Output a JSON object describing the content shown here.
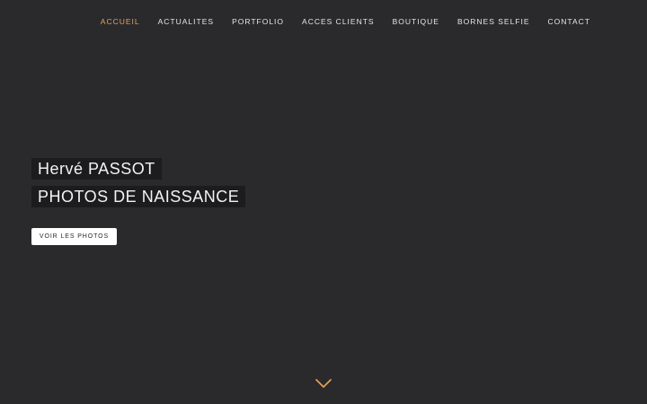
{
  "nav": {
    "items": [
      {
        "label": "ACCUEIL",
        "active": true
      },
      {
        "label": "ACTUALITES",
        "active": false
      },
      {
        "label": "PORTFOLIO",
        "active": false
      },
      {
        "label": "ACCES CLIENTS",
        "active": false
      },
      {
        "label": "BOUTIQUE",
        "active": false
      },
      {
        "label": "BORNES SELFIE",
        "active": false
      },
      {
        "label": "CONTACT",
        "active": false
      }
    ]
  },
  "hero": {
    "title_line1": "Hervé PASSOT",
    "title_line2": "PHOTOS DE NAISSANCE",
    "cta_label": "VOIR LES PHOTOS",
    "scroll_icon": "chevron-down-icon"
  },
  "colors": {
    "background": "#2a2a2d",
    "accent": "#e8a258",
    "title_box": "#1c1c1e",
    "text": "#f2f2f2"
  }
}
